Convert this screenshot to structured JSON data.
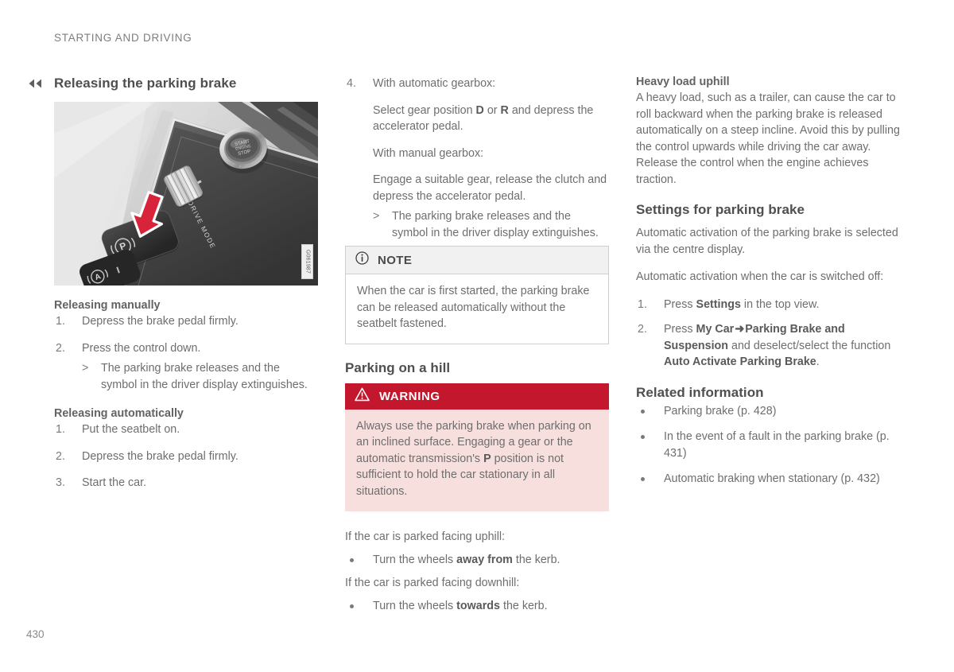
{
  "header": {
    "running_title": "STARTING AND DRIVING",
    "page_number": "430",
    "continuation_icon": "double-chevron-left-icon"
  },
  "colors": {
    "warning_header_bg": "#c2172c",
    "warning_body_bg": "#f7dfdd",
    "note_header_bg": "#f1f1f1",
    "note_border": "#cfcfcf",
    "body_text": "#6e6e6e",
    "heading_text": "#4f4f4f",
    "arrow_marker_red": "#d8243a"
  },
  "column_left": {
    "section_title": "Releasing the parking brake",
    "figure": {
      "id_label": "G061987",
      "alt_name": "centre-console-parking-brake-illustration",
      "labels": {
        "start_button": "START ENGINE STOP",
        "drive_mode": "DRIVE MODE",
        "parking_brake_symbol": "P",
        "auto_hold_symbol": "A"
      }
    },
    "manual": {
      "heading": "Releasing manually",
      "steps": [
        {
          "num": "1.",
          "text": "Depress the brake pedal firmly."
        },
        {
          "num": "2.",
          "text": "Press the control down."
        }
      ],
      "result_marker": ">",
      "result_text": "The parking brake releases and the symbol in the driver display extinguishes."
    },
    "automatic": {
      "heading": "Releasing automatically",
      "steps": [
        {
          "num": "1.",
          "text": "Put the seatbelt on."
        },
        {
          "num": "2.",
          "text": "Depress the brake pedal firmly."
        },
        {
          "num": "3.",
          "text": "Start the car."
        }
      ]
    }
  },
  "column_middle": {
    "step4": {
      "num": "4.",
      "lead": "With automatic gearbox:",
      "para_auto_pre": "Select gear position ",
      "para_auto_bold1": "D",
      "para_auto_mid": " or ",
      "para_auto_bold2": "R",
      "para_auto_post": " and depress the accelerator pedal.",
      "manual_lead": "With manual gearbox:",
      "manual_para": "Engage a suitable gear, release the clutch and depress the accelerator pedal.",
      "result_marker": ">",
      "result_text": "The parking brake releases and the symbol in the driver display extinguishes."
    },
    "note": {
      "icon": "info-circle-icon",
      "label": "NOTE",
      "text": "When the car is first started, the parking brake can be released automatically without the seatbelt fastened."
    },
    "hill": {
      "heading": "Parking on a hill",
      "warning": {
        "icon": "warning-triangle-icon",
        "label": "WARNING",
        "text_pre": "Always use the parking brake when parking on an inclined surface. Engaging a gear or the automatic transmission's ",
        "text_bold": "P",
        "text_post": " position is not sufficient to hold the car stationary in all situations."
      },
      "uphill_lead": "If the car is parked facing uphill:",
      "uphill_bullet_pre": "Turn the wheels ",
      "uphill_bullet_bold": "away from",
      "uphill_bullet_post": " the kerb.",
      "downhill_lead": "If the car is parked facing downhill:",
      "downhill_bullet_pre": "Turn the wheels ",
      "downhill_bullet_bold": "towards",
      "downhill_bullet_post": " the kerb."
    }
  },
  "column_right": {
    "heavy_load": {
      "heading": "Heavy load uphill",
      "text": "A heavy load, such as a trailer, can cause the car to roll backward when the parking brake is released automatically on a steep incline. Avoid this by pulling the control upwards while driving the car away. Release the control when the engine achieves traction."
    },
    "settings": {
      "heading": "Settings for parking brake",
      "para1": "Automatic activation of the parking brake is selected via the centre display.",
      "para2": "Automatic activation when the car is switched off:",
      "step1": {
        "num": "1.",
        "pre": "Press ",
        "bold": "Settings",
        "post": " in the top view."
      },
      "step2": {
        "num": "2.",
        "pre": "Press ",
        "bold1": "My Car",
        "arrow": "➜",
        "bold2": "Parking Brake and Suspension",
        "mid": " and deselect/select the function ",
        "bold3": "Auto Activate Parking Brake",
        "post": "."
      }
    },
    "related": {
      "heading": "Related information",
      "items": [
        "Parking brake (p. 428)",
        "In the event of a fault in the parking brake (p. 431)",
        "Automatic braking when stationary (p. 432)"
      ]
    }
  }
}
